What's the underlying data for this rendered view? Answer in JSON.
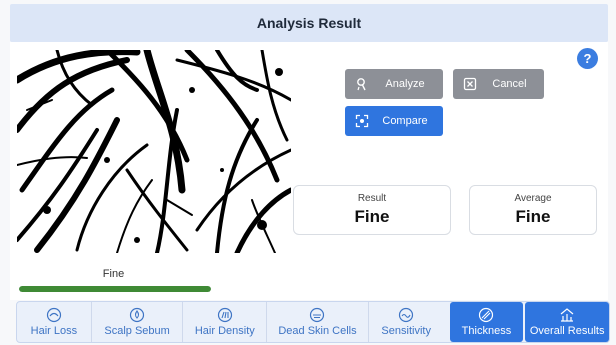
{
  "header": {
    "title": "Analysis Result"
  },
  "help": {
    "label": "?"
  },
  "scan_image": {
    "description_icon": "hair-thickness-scan"
  },
  "actions": {
    "analyze_label": "Analyze",
    "cancel_label": "Cancel",
    "compare_label": "Compare"
  },
  "result_card": {
    "caption": "Result",
    "value": "Fine"
  },
  "average_card": {
    "caption": "Average",
    "value": "Fine"
  },
  "level": {
    "label": "Fine",
    "fill_fraction": 1.0,
    "color": "#3f8a35"
  },
  "tabs": [
    {
      "label": "Hair Loss",
      "icon": "hair-loss-icon",
      "active": false
    },
    {
      "label": "Scalp Sebum",
      "icon": "scalp-sebum-icon",
      "active": false
    },
    {
      "label": "Hair Density",
      "icon": "hair-density-icon",
      "active": false
    },
    {
      "label": "Dead Skin Cells",
      "icon": "dead-skin-cells-icon",
      "active": false
    },
    {
      "label": "Sensitivity",
      "icon": "sensitivity-icon",
      "active": false
    },
    {
      "label": "Thickness",
      "icon": "thickness-icon",
      "active": true
    },
    {
      "label": "Overall Results",
      "icon": "overall-results-icon",
      "active": true
    }
  ],
  "colors": {
    "accent": "#2f75df",
    "disabled_button": "#8d9097",
    "title_bg": "#dce6f7"
  }
}
